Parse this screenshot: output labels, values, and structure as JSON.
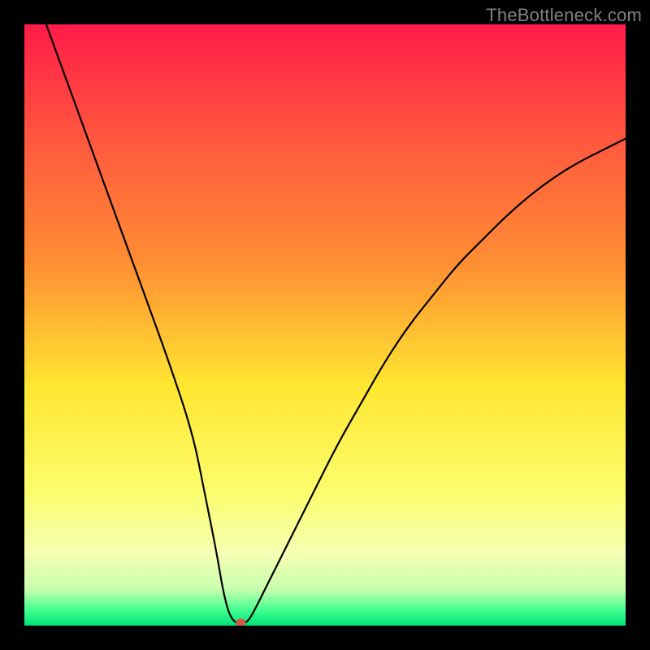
{
  "watermark": "TheBottleneck.com",
  "chart_data": {
    "type": "line",
    "title": "",
    "xlabel": "",
    "ylabel": "",
    "xlim": [
      0,
      100
    ],
    "ylim": [
      0,
      100
    ],
    "grid": false,
    "legend": false,
    "gradient_stops": [
      {
        "offset": 0.0,
        "color": "#ff1b48"
      },
      {
        "offset": 0.2,
        "color": "#ff5a3e"
      },
      {
        "offset": 0.4,
        "color": "#ff8f33"
      },
      {
        "offset": 0.6,
        "color": "#ffe631"
      },
      {
        "offset": 0.78,
        "color": "#fcfe6e"
      },
      {
        "offset": 0.88,
        "color": "#f6ffb3"
      },
      {
        "offset": 0.94,
        "color": "#c7ffae"
      },
      {
        "offset": 0.975,
        "color": "#3fff8e"
      },
      {
        "offset": 1.0,
        "color": "#00e17a"
      }
    ],
    "series": [
      {
        "name": "bottleneck-curve",
        "x": [
          0,
          4,
          8,
          12,
          16,
          20,
          24,
          28,
          30,
          32,
          33,
          34,
          35,
          36,
          37,
          38,
          40,
          44,
          48,
          52,
          56,
          60,
          64,
          68,
          72,
          76,
          80,
          84,
          88,
          92,
          96,
          100
        ],
        "y": [
          110,
          99,
          88,
          77,
          66,
          55,
          44,
          32,
          22,
          12,
          6,
          2,
          0.5,
          0.5,
          0.5,
          2,
          6,
          14,
          22,
          30,
          37,
          44,
          50,
          55,
          60,
          64,
          68,
          71.5,
          74.5,
          77,
          79,
          81
        ]
      }
    ],
    "marker": {
      "x": 36,
      "y": 0.5,
      "color": "#d6584b",
      "rx": 6,
      "ry": 5
    }
  }
}
